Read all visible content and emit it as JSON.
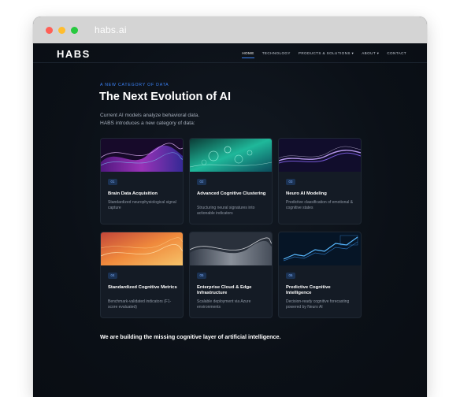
{
  "browser": {
    "url": "habs.ai"
  },
  "nav": {
    "logo": "HABS",
    "links": [
      "HOME",
      "TECHNOLOGY",
      "PRODUCTS & SOLUTIONS ▾",
      "ABOUT ▾",
      "CONTACT"
    ]
  },
  "hero": {
    "eyebrow": "A NEW CATEGORY OF DATA",
    "title": "The Next Evolution of AI",
    "intro_line1": "Current AI models analyze behavioral data.",
    "intro_line2": "HABS introduces a new category of data:"
  },
  "cards": [
    {
      "num": "01",
      "title": "Brain Data Acquisition",
      "desc": "Standardized neurophysiological signal capture",
      "image": "purple-neural-wave"
    },
    {
      "num": "02",
      "title": "Advanced Cognitive Clustering",
      "desc": "Structuring neural signatures into actionable indicators",
      "image": "teal-bubbles"
    },
    {
      "num": "03",
      "title": "Neuro AI Modeling",
      "desc": "Predictive classification of emotional & cognitive states",
      "image": "violet-light-wave"
    },
    {
      "num": "04",
      "title": "Standardized Cognitive Metrics",
      "desc": "Benchmark-validated indicators (F1-score evaluated)",
      "image": "orange-flow"
    },
    {
      "num": "05",
      "title": "Enterprise Cloud & Edge Infrastructure",
      "desc": "Scalable deployment via Azure environments",
      "image": "silver-waves"
    },
    {
      "num": "06",
      "title": "Predictive Cognitive Intelligence",
      "desc": "Decision-ready cognitive forecasting powered by Neuro AI",
      "image": "blue-data-chart"
    }
  ],
  "footer": {
    "statement": "We are building the missing cognitive layer of artificial intelligence."
  },
  "colors": {
    "accent": "#3b82f6",
    "background": "#0c1118",
    "card": "#141b25"
  }
}
